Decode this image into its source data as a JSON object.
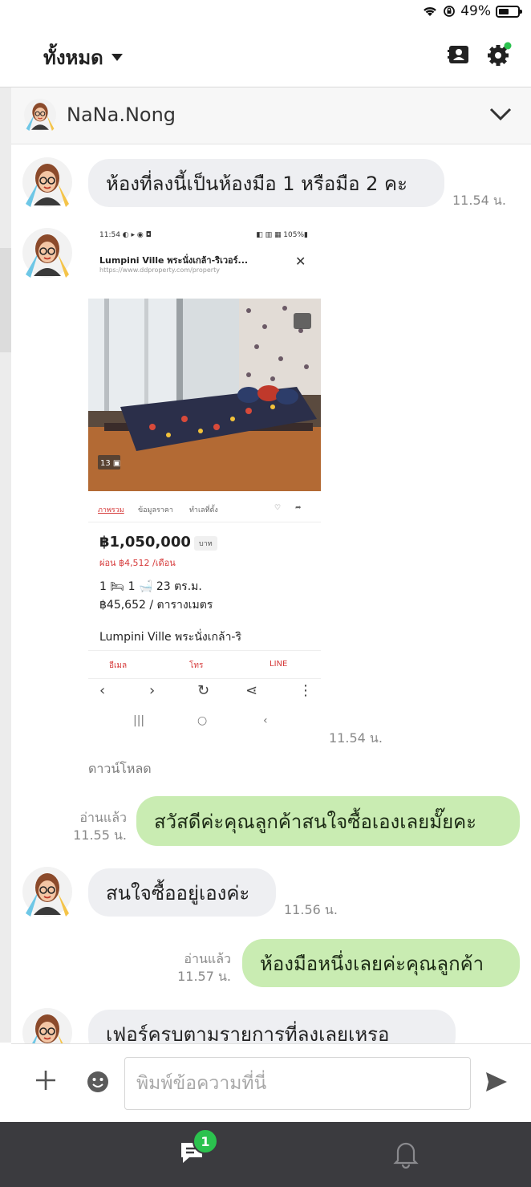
{
  "status_bar": {
    "battery": "49%"
  },
  "header": {
    "filter_label": "ทั้งหมด"
  },
  "chat_header": {
    "name": "NaNa.Nong"
  },
  "messages": [
    {
      "from": "customer",
      "text": "ห้องที่ลงนี้เป็นห้องมือ 1 หรือมือ 2 คะ",
      "time": "11.54 น."
    },
    {
      "from": "customer",
      "type": "image",
      "time": "11.54 น.",
      "download": "ดาวน์โหลด"
    },
    {
      "from": "agent",
      "text": "สวัสดีค่ะคุณลูกค้าสนใจซื้อเองเลยมั๊ยคะ",
      "read": "อ่านแล้ว",
      "time": "11.55 น."
    },
    {
      "from": "customer",
      "text": "สนใจซื้ออยู่เองค่ะ",
      "time": "11.56 น."
    },
    {
      "from": "agent",
      "text": "ห้องมือหนึ่งเลยค่ะคุณลูกค้า",
      "read": "อ่านแล้ว",
      "time": "11.57 น."
    },
    {
      "from": "customer",
      "text": "เฟอร์ครบตามรายการที่ลงเลยเหรอ"
    }
  ],
  "shared_screenshot": {
    "title": "Lumpini Ville พระนั่งเกล้า-ริเวอร์...",
    "url": "https://www.ddproperty.com/property",
    "photo_count": "13",
    "tabs": [
      "ภาพรวม",
      "ข้อมูลราคา",
      "ทำเลที่ตั้ง"
    ],
    "price": "฿1,050,000",
    "price_unit": "บาท",
    "installment": "ผ่อน ฿4,512 /เดือน",
    "specs": "1 🛏  1 🛁  23 ตร.ม.",
    "price_per_sqm": "฿45,652 / ตารางเมตร",
    "project_name": "Lumpini Ville พระนั่งเกล้า-ริ",
    "actions": [
      "อีเมล",
      "โทร",
      "LINE"
    ]
  },
  "composer": {
    "placeholder": "พิมพ์ข้อความที่นี่"
  },
  "bottom_nav": {
    "chat_badge": "1"
  },
  "colors": {
    "agent_bubble": "#c9ecb2",
    "customer_bubble": "#eeeff2",
    "bottom_bar": "#3b3b3f",
    "badge": "#2bc24e"
  }
}
